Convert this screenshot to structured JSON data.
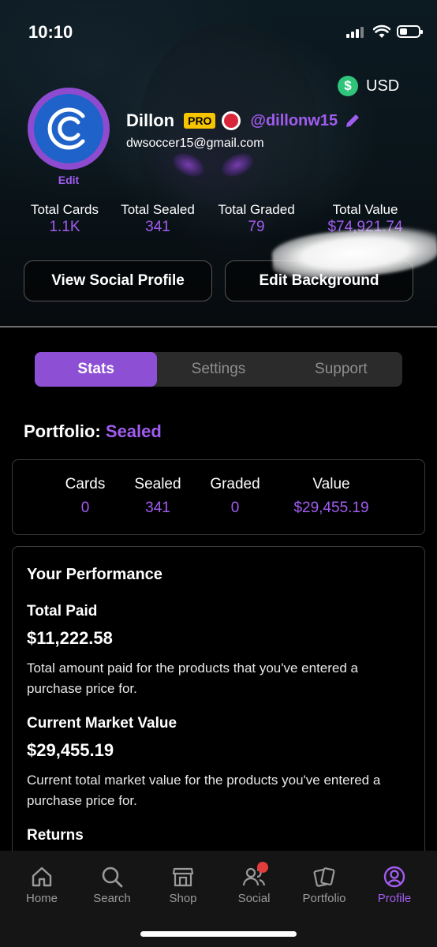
{
  "status_bar": {
    "time": "10:10"
  },
  "currency": {
    "symbol": "$",
    "label": "USD"
  },
  "profile": {
    "avatar_edit": "Edit",
    "name": "Dillon",
    "badge": "PRO",
    "handle": "@dillonw15",
    "email": "dwsoccer15@gmail.com"
  },
  "totals": [
    {
      "label": "Total Cards",
      "value": "1.1K"
    },
    {
      "label": "Total Sealed",
      "value": "341"
    },
    {
      "label": "Total Graded",
      "value": "79"
    },
    {
      "label": "Total Value",
      "value": "$74,921.74"
    }
  ],
  "buttons": {
    "social": "View Social Profile",
    "background": "Edit Background"
  },
  "tabs": [
    {
      "label": "Stats",
      "active": true
    },
    {
      "label": "Settings",
      "active": false
    },
    {
      "label": "Support",
      "active": false
    }
  ],
  "portfolio": {
    "prefix": "Portfolio:",
    "type": "Sealed"
  },
  "summary": [
    {
      "label": "Cards",
      "value": "0"
    },
    {
      "label": "Sealed",
      "value": "341"
    },
    {
      "label": "Graded",
      "value": "0"
    },
    {
      "label": "Value",
      "value": "$29,455.19"
    }
  ],
  "performance": {
    "title": "Your Performance",
    "total_paid": {
      "label": "Total Paid",
      "amount": "$11,222.58",
      "desc": "Total amount paid for the products that you've entered a purchase price for."
    },
    "market_value": {
      "label": "Current Market Value",
      "amount": "$29,455.19",
      "desc": "Current total market value for the products you've entered a purchase price for."
    },
    "returns_label": "Returns"
  },
  "nav": [
    {
      "label": "Home",
      "icon": "home-icon"
    },
    {
      "label": "Search",
      "icon": "search-icon"
    },
    {
      "label": "Shop",
      "icon": "shop-icon"
    },
    {
      "label": "Social",
      "icon": "social-icon"
    },
    {
      "label": "Portfolio",
      "icon": "portfolio-icon"
    },
    {
      "label": "Profile",
      "icon": "profile-icon"
    }
  ],
  "colors": {
    "accent": "#a15cf0",
    "active_tab": "#8d4fd4",
    "pro": "#f7c400",
    "currency": "#2fc47a"
  }
}
